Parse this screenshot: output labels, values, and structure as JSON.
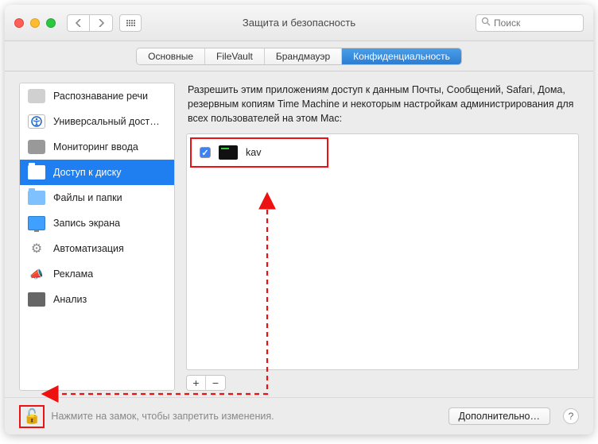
{
  "window": {
    "title": "Защита и безопасность",
    "search_placeholder": "Поиск"
  },
  "tabs": [
    {
      "label": "Основные",
      "active": false
    },
    {
      "label": "FileVault",
      "active": false
    },
    {
      "label": "Брандмауэр",
      "active": false
    },
    {
      "label": "Конфиденциальность",
      "active": true
    }
  ],
  "sidebar": {
    "items": [
      {
        "label": "Распознавание речи",
        "icon": "waveform",
        "active": false
      },
      {
        "label": "Универсальный дост…",
        "icon": "accessibility",
        "active": false
      },
      {
        "label": "Мониторинг ввода",
        "icon": "keyboard",
        "active": false
      },
      {
        "label": "Доступ к диску",
        "icon": "folder",
        "active": true
      },
      {
        "label": "Файлы и папки",
        "icon": "folder-light",
        "active": false
      },
      {
        "label": "Запись экрана",
        "icon": "monitor",
        "active": false
      },
      {
        "label": "Автоматизация",
        "icon": "gear",
        "active": false
      },
      {
        "label": "Реклама",
        "icon": "megaphone",
        "active": false
      },
      {
        "label": "Анализ",
        "icon": "chart",
        "active": false
      }
    ]
  },
  "main": {
    "description": "Разрешить этим приложениям доступ к данным Почты, Сообщений, Safari, Дома, резервным копиям Time Machine и некоторым настройкам администрирования для всех пользователей на этом Mac:",
    "apps": [
      {
        "name": "kav",
        "checked": true
      }
    ],
    "plus": "+",
    "minus": "−"
  },
  "footer": {
    "lock_text": "Нажмите на замок, чтобы запретить изменения.",
    "advanced_label": "Дополнительно…",
    "help_label": "?"
  },
  "annotation": {
    "highlight_color": "#e11"
  }
}
